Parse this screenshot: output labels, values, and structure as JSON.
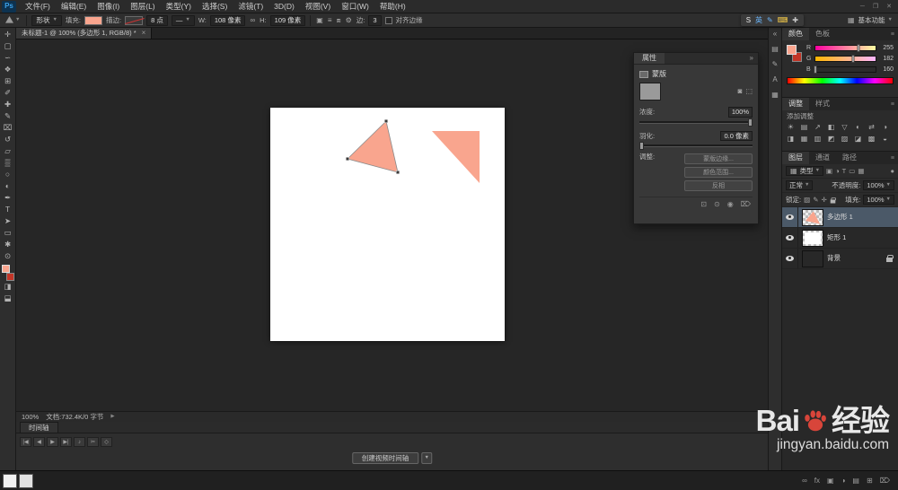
{
  "colors": {
    "shape_fill": "#f9a58e",
    "background_swatch": "#c23527"
  },
  "menubar": {
    "logo": "Ps",
    "items": [
      "文件(F)",
      "编辑(E)",
      "图像(I)",
      "图层(L)",
      "类型(Y)",
      "选择(S)",
      "滤镜(T)",
      "3D(D)",
      "视图(V)",
      "窗口(W)",
      "帮助(H)"
    ],
    "window_buttons": [
      "─",
      "❐",
      "✕"
    ]
  },
  "optionsbar": {
    "mode": "形状",
    "fill_label": "填充:",
    "stroke_label": "描边:",
    "stroke_width": "8 点",
    "stroke_style": "—",
    "w_label": "W:",
    "w_value": "108 像素",
    "link_icon": "∞",
    "h_label": "H:",
    "h_value": "109 像素",
    "path_op_icons": [
      "▣",
      "≡",
      "⧈",
      "⚙"
    ],
    "sides_label": "边:",
    "sides_value": "3",
    "align_edges": "对齐边缘",
    "workspace_icon": "▦",
    "workspace": "基本功能"
  },
  "sogou": {
    "items": [
      "S",
      "英",
      "✎",
      "⌨",
      "✚"
    ]
  },
  "document": {
    "tab_title": "未标题-1 @ 100% (多边形 1, RGB/8) *",
    "tab_close": "×"
  },
  "toolbar": {
    "tools": [
      {
        "name": "move-tool-icon",
        "glyph": "✛"
      },
      {
        "name": "marquee-tool-icon",
        "glyph": "▢"
      },
      {
        "name": "lasso-tool-icon",
        "glyph": "∽"
      },
      {
        "name": "quick-selection-tool-icon",
        "glyph": "❖"
      },
      {
        "name": "crop-tool-icon",
        "glyph": "⊞"
      },
      {
        "name": "eyedropper-tool-icon",
        "glyph": "✐"
      },
      {
        "name": "healing-brush-tool-icon",
        "glyph": "✚"
      },
      {
        "name": "brush-tool-icon",
        "glyph": "✎"
      },
      {
        "name": "clone-stamp-tool-icon",
        "glyph": "⌧"
      },
      {
        "name": "history-brush-tool-icon",
        "glyph": "↺"
      },
      {
        "name": "eraser-tool-icon",
        "glyph": "▱"
      },
      {
        "name": "gradient-tool-icon",
        "glyph": "▒"
      },
      {
        "name": "blur-tool-icon",
        "glyph": "○"
      },
      {
        "name": "dodge-tool-icon",
        "glyph": "◐"
      },
      {
        "name": "pen-tool-icon",
        "glyph": "✒"
      },
      {
        "name": "type-tool-icon",
        "glyph": "T"
      },
      {
        "name": "path-selection-tool-icon",
        "glyph": "➤"
      },
      {
        "name": "shape-tool-icon",
        "glyph": "▭"
      },
      {
        "name": "hand-tool-icon",
        "glyph": "✱"
      },
      {
        "name": "zoom-tool-icon",
        "glyph": "⊙"
      }
    ],
    "extra": [
      {
        "name": "quick-mask-icon",
        "glyph": "◨"
      },
      {
        "name": "screen-mode-icon",
        "glyph": "⬓"
      }
    ]
  },
  "properties_panel": {
    "tab": "属性",
    "collapse_icon": "»",
    "section_label": "蒙版",
    "add_buttons": [
      "◙",
      "⬚"
    ],
    "density_label": "浓度:",
    "density_value": "100%",
    "feather_label": "羽化:",
    "feather_value": "0.0 像素",
    "refine_label": "调整:",
    "refine_buttons": [
      "蒙版边缘...",
      "颜色范围...",
      "反相"
    ],
    "footer_icons": [
      {
        "name": "load-selection-icon",
        "glyph": "⊡"
      },
      {
        "name": "apply-mask-icon",
        "glyph": "⊙"
      },
      {
        "name": "toggle-mask-icon",
        "glyph": "◉"
      },
      {
        "name": "delete-mask-icon",
        "glyph": "⌦"
      }
    ]
  },
  "status_bar": {
    "zoom": "100%",
    "doc_info": "文档:732.4K/0 字节",
    "popup_arrow": "▶"
  },
  "timeline": {
    "tab": "时间轴",
    "transport": [
      {
        "name": "first-frame-button",
        "glyph": "|◀"
      },
      {
        "name": "prev-frame-button",
        "glyph": "◀"
      },
      {
        "name": "play-button",
        "glyph": "▶"
      },
      {
        "name": "next-frame-button",
        "glyph": "▶|"
      },
      {
        "name": "audio-button",
        "glyph": "♪"
      },
      {
        "name": "split-button",
        "glyph": "✂"
      },
      {
        "name": "transition-button",
        "glyph": "◇"
      }
    ],
    "create_button": "创建视频时间轴",
    "create_dropdown": "▼"
  },
  "panel_strip": {
    "icons": [
      {
        "name": "expand-panels-icon",
        "glyph": "«"
      },
      {
        "name": "swatches-panel-icon",
        "glyph": "▤"
      },
      {
        "name": "brush-panel-icon",
        "glyph": "✎"
      },
      {
        "name": "character-panel-icon",
        "glyph": "A"
      },
      {
        "name": "clone-source-panel-icon",
        "glyph": "▦"
      }
    ]
  },
  "color_panel": {
    "tabs": [
      "颜色",
      "色板"
    ],
    "channels": [
      {
        "label": "R",
        "value": "255"
      },
      {
        "label": "G",
        "value": "182"
      },
      {
        "label": "B",
        "value": "160"
      }
    ]
  },
  "adjustments_panel": {
    "tabs": [
      "调整",
      "样式"
    ],
    "title": "添加调整",
    "icons": [
      {
        "name": "brightness-contrast-icon",
        "glyph": "☀"
      },
      {
        "name": "levels-icon",
        "glyph": "▤"
      },
      {
        "name": "curves-icon",
        "glyph": "↗"
      },
      {
        "name": "exposure-icon",
        "glyph": "◧"
      },
      {
        "name": "vibrance-icon",
        "glyph": "▽"
      },
      {
        "name": "hue-saturation-icon",
        "glyph": "◐"
      },
      {
        "name": "color-balance-icon",
        "glyph": "⇄"
      },
      {
        "name": "black-white-icon",
        "glyph": "◑"
      },
      {
        "name": "photo-filter-icon",
        "glyph": "◨"
      },
      {
        "name": "channel-mixer-icon",
        "glyph": "▦"
      },
      {
        "name": "color-lookup-icon",
        "glyph": "▥"
      },
      {
        "name": "invert-icon",
        "glyph": "◩"
      },
      {
        "name": "posterize-icon",
        "glyph": "▨"
      },
      {
        "name": "threshold-icon",
        "glyph": "◪"
      },
      {
        "name": "gradient-map-icon",
        "glyph": "▩"
      },
      {
        "name": "selective-color-icon",
        "glyph": "◒"
      }
    ]
  },
  "layers_panel": {
    "tabs": [
      "图层",
      "通道",
      "路径"
    ],
    "filter_label": "类型",
    "filter_icons": [
      {
        "name": "filter-pixel-layers-icon",
        "glyph": "▣"
      },
      {
        "name": "filter-adjustment-layers-icon",
        "glyph": "◑"
      },
      {
        "name": "filter-type-layers-icon",
        "glyph": "T"
      },
      {
        "name": "filter-shape-layers-icon",
        "glyph": "▭"
      },
      {
        "name": "filter-smart-objects-icon",
        "glyph": "▦"
      }
    ],
    "filter_toggle_icon": "●",
    "blend_mode": "正常",
    "opacity_label": "不透明度:",
    "opacity_value": "100%",
    "lock_label": "锁定:",
    "lock_icons": [
      "▨",
      "✎",
      "✛"
    ],
    "fill_label": "填充:",
    "fill_value": "100%",
    "layers": [
      {
        "name": "多边形 1",
        "selected": true
      },
      {
        "name": "矩形 1",
        "selected": false
      },
      {
        "name": "背景",
        "selected": false,
        "locked": true
      }
    ]
  },
  "bottom_bar": {
    "icons": [
      {
        "name": "link-layers-icon",
        "glyph": "∞"
      },
      {
        "name": "layer-style-icon",
        "glyph": "fx"
      },
      {
        "name": "add-mask-icon",
        "glyph": "▣"
      },
      {
        "name": "new-adjustment-icon",
        "glyph": "◑"
      },
      {
        "name": "new-group-icon",
        "glyph": "▤"
      },
      {
        "name": "new-layer-icon",
        "glyph": "⊞"
      },
      {
        "name": "delete-layer-icon",
        "glyph": "⌦"
      }
    ]
  },
  "watermark": {
    "brand_prefix": "Bai",
    "brand_suffix": "经验",
    "url": "jingyan.baidu.com"
  }
}
